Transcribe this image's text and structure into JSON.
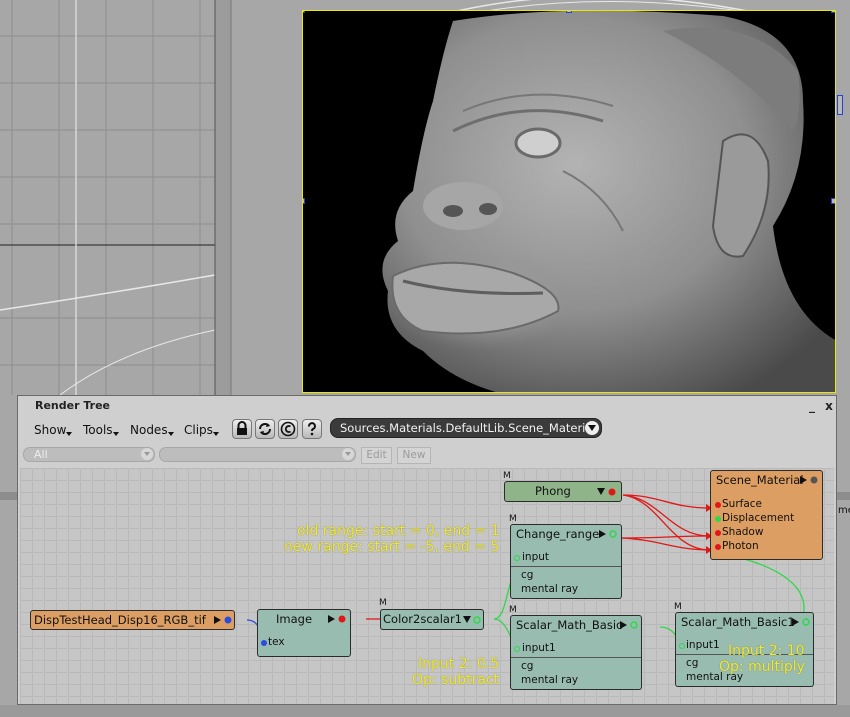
{
  "render_tree": {
    "title": "Render Tree",
    "window_buttons": {
      "minimize": "_",
      "close": "x"
    },
    "menus": [
      "Show",
      "Tools",
      "Nodes",
      "Clips"
    ],
    "toolbar_icons": [
      "lock-icon",
      "refresh-icon",
      "copyright-icon",
      "help-icon"
    ],
    "path": "Sources.Materials.DefaultLib.Scene_Materi",
    "filter": {
      "selected": "All",
      "second": ""
    },
    "buttons": {
      "edit": "Edit",
      "new": "New"
    }
  },
  "nodes": {
    "phong": {
      "m": "M",
      "title": "Phong"
    },
    "scene_material": {
      "title": "Scene_Material",
      "ports": [
        "Surface",
        "Displacement",
        "Shadow",
        "Photon"
      ]
    },
    "change_range": {
      "m": "M",
      "title": "Change_range",
      "port": "input",
      "subs": [
        "cg",
        "mental ray"
      ]
    },
    "disp_tex": {
      "title": "DispTestHead_Disp16_RGB_tif"
    },
    "image": {
      "title": "Image",
      "port": "tex"
    },
    "color2scalar": {
      "m": "M",
      "title": "Color2scalar1"
    },
    "scalar_math_basic": {
      "m": "M",
      "title": "Scalar_Math_Basic",
      "port": "input1",
      "subs": [
        "cg",
        "mental ray"
      ]
    },
    "scalar_math_basic1": {
      "m": "M",
      "title": "Scalar_Math_Basic1",
      "port": "input1",
      "subs": [
        "cg",
        "mental ray"
      ]
    }
  },
  "annotations": {
    "old_range": "old range: start = 0, end = 1",
    "new_range": "new range: start = -5, end = 5",
    "input2_a": "Input 2: 0.5",
    "op_a": "Op: subtract",
    "input2_b": "Input 2: 10",
    "op_b": "Op: multiply"
  },
  "edge_label": "me",
  "colors": {
    "node_green": "#99bcb0",
    "node_orange": "#dc9e63",
    "phong_green": "#8fb48a",
    "wire_red": "#e01818",
    "wire_green": "#2ed84a",
    "wire_blue": "#2a4ce0",
    "annotation_yellow": "#f0ea2a"
  }
}
